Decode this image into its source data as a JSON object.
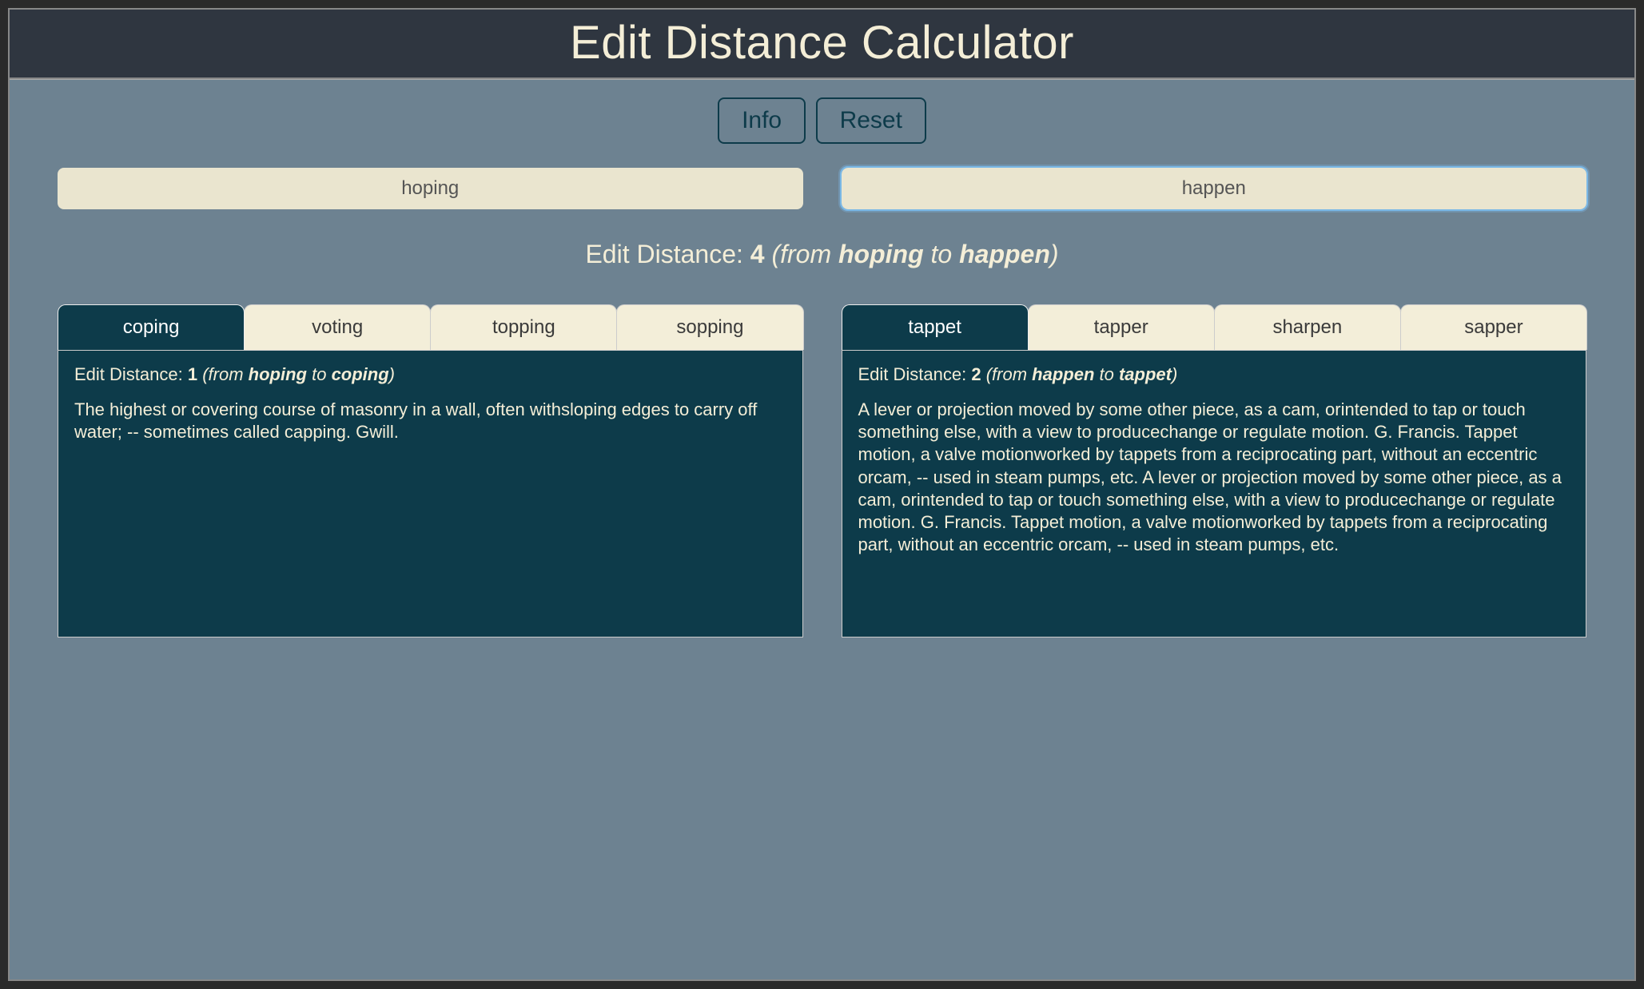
{
  "header": {
    "title": "Edit Distance Calculator"
  },
  "buttons": {
    "info": "Info",
    "reset": "Reset"
  },
  "inputs": {
    "left": "hoping",
    "right": "happen"
  },
  "result": {
    "label": "Edit Distance: ",
    "value": "4",
    "open": " (",
    "from": "from ",
    "word1": "hoping",
    "to": " to ",
    "word2": "happen",
    "close": ")"
  },
  "leftPanel": {
    "tabs": [
      "coping",
      "voting",
      "topping",
      "sopping"
    ],
    "activeIndex": 0,
    "ed": {
      "label": "Edit Distance: ",
      "value": "1",
      "open": " (",
      "from": "from ",
      "word1": "hoping",
      "to": " to ",
      "word2": "coping",
      "close": ")"
    },
    "def": "The highest or covering course of masonry in a wall, often withsloping edges to carry off water; -- sometimes called capping. Gwill."
  },
  "rightPanel": {
    "tabs": [
      "tappet",
      "tapper",
      "sharpen",
      "sapper"
    ],
    "activeIndex": 0,
    "ed": {
      "label": "Edit Distance: ",
      "value": "2",
      "open": " (",
      "from": "from ",
      "word1": "happen",
      "to": " to ",
      "word2": "tappet",
      "close": ")"
    },
    "def": "A lever or projection moved by some other piece, as a cam, orintended to tap or touch something else, with a view to producechange or regulate motion. G. Francis. Tappet motion, a valve motionworked by tappets from a reciprocating part, without an eccentric orcam, -- used in steam pumps, etc. A lever or projection moved by some other piece, as a cam, orintended to tap or touch something else, with a view to producechange or regulate motion. G. Francis. Tappet motion, a valve motionworked by tappets from a reciprocating part, without an eccentric orcam, -- used in steam pumps, etc."
  }
}
